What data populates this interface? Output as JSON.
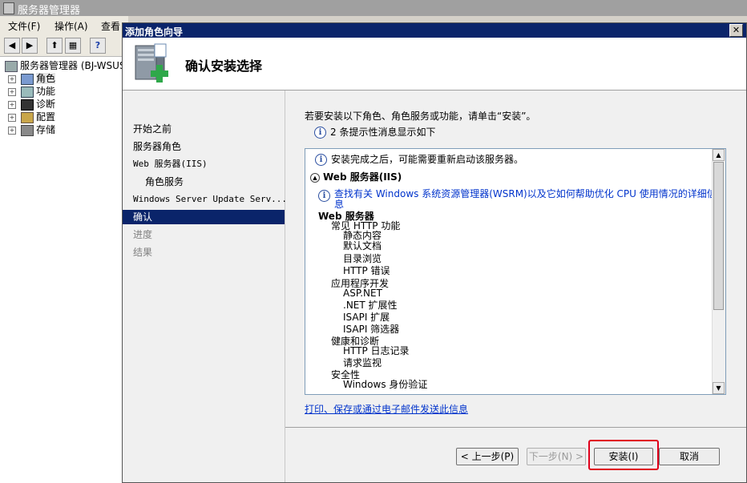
{
  "background_window": {
    "title": "服务器管理器",
    "menu": [
      "文件(F)",
      "操作(A)",
      "查看"
    ],
    "tree": {
      "root": "服务器管理器 (BJ-WSUS",
      "items": [
        "角色",
        "功能",
        "诊断",
        "配置",
        "存储"
      ]
    }
  },
  "dialog": {
    "title": "添加角色向导",
    "close_glyph": "✕",
    "heading": "确认安装选择",
    "nav": [
      {
        "label": "开始之前",
        "state": "normal",
        "sub": false
      },
      {
        "label": "服务器角色",
        "state": "normal",
        "sub": false
      },
      {
        "label": "Web 服务器(IIS)",
        "state": "normal",
        "sub": false
      },
      {
        "label": "角色服务",
        "state": "normal",
        "sub": true
      },
      {
        "label": "Windows Server Update Serv...",
        "state": "normal",
        "sub": false
      },
      {
        "label": "确认",
        "state": "active",
        "sub": false
      },
      {
        "label": "进度",
        "state": "disabled",
        "sub": false
      },
      {
        "label": "结果",
        "state": "disabled",
        "sub": false
      }
    ],
    "intro": "若要安装以下角色、角色服务或功能，请单击“安装”。",
    "info_count": "2 条提示性消息显示如下",
    "list": {
      "restart_msg": "安装完成之后，可能需要重新启动该服务器。",
      "section_title": "Web 服务器(IIS)",
      "help_link": "查找有关 Windows 系统资源管理器(WSRM)以及它如何帮助优化 CPU 使用情况的详细信息",
      "features": [
        {
          "label": "Web 服务器",
          "level": 0
        },
        {
          "label": "常见 HTTP 功能",
          "level": 1
        },
        {
          "label": "静态内容",
          "level": 2
        },
        {
          "label": "默认文档",
          "level": 2
        },
        {
          "label": "目录浏览",
          "level": 2
        },
        {
          "label": "HTTP 错误",
          "level": 2
        },
        {
          "label": "应用程序开发",
          "level": 1
        },
        {
          "label": "ASP.NET",
          "level": 2
        },
        {
          "label": ".NET 扩展性",
          "level": 2
        },
        {
          "label": "ISAPI 扩展",
          "level": 2
        },
        {
          "label": "ISAPI 筛选器",
          "level": 2
        },
        {
          "label": "健康和诊断",
          "level": 1
        },
        {
          "label": "HTTP 日志记录",
          "level": 2
        },
        {
          "label": "请求监视",
          "level": 2
        },
        {
          "label": "安全性",
          "level": 1
        },
        {
          "label": "Windows 身份验证",
          "level": 2
        }
      ]
    },
    "more_link": "打印、保存或通过电子邮件发送此信息",
    "buttons": {
      "prev": "< 上一步(P)",
      "next": "下一步(N) >",
      "install": "安装(I)",
      "cancel": "取消"
    },
    "colors": {
      "highlight": "#e0001b",
      "selection": "#0a246a",
      "link": "#0033cc"
    }
  }
}
